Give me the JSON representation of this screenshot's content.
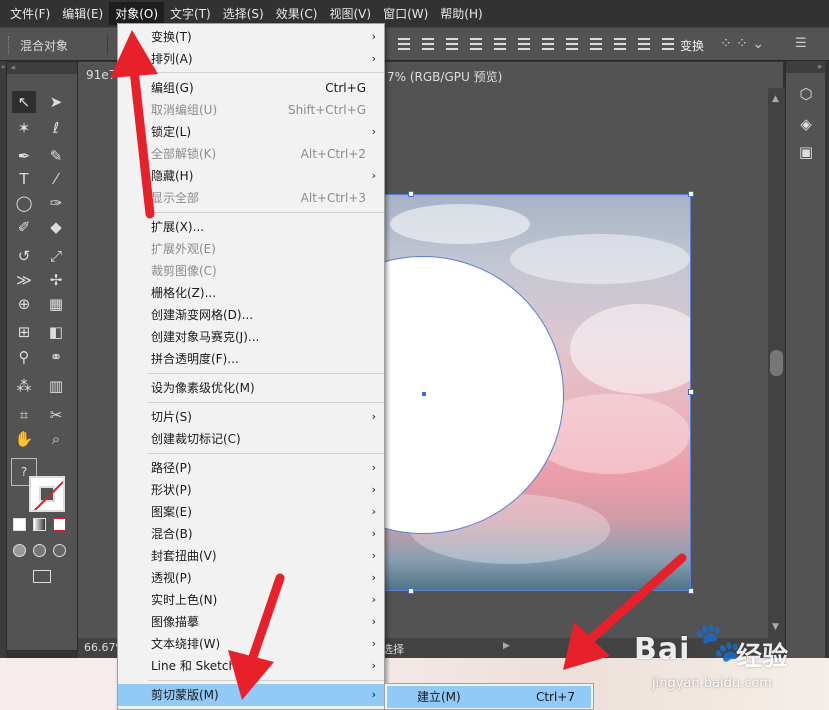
{
  "menubar": {
    "items": [
      "文件(F)",
      "编辑(E)",
      "对象(O)",
      "文字(T)",
      "选择(S)",
      "效果(C)",
      "视图(V)",
      "窗口(W)",
      "帮助(H)"
    ]
  },
  "control_bar": {
    "selection_label": "混合对象",
    "transform_label": "变换"
  },
  "document": {
    "tab_name_start": "91e7",
    "tab_name_end": "7% (RGB/GPU 预览)",
    "zoom": "66.67%",
    "status_text": "选择"
  },
  "object_menu": {
    "items": [
      {
        "label": "变换(T)",
        "shortcut": "",
        "submenu": true,
        "disabled": false
      },
      {
        "label": "排列(A)",
        "shortcut": "",
        "submenu": true,
        "disabled": false
      },
      {
        "label": "编组(G)",
        "shortcut": "Ctrl+G",
        "submenu": false,
        "disabled": false
      },
      {
        "label": "取消编组(U)",
        "shortcut": "Shift+Ctrl+G",
        "submenu": false,
        "disabled": true
      },
      {
        "label": "锁定(L)",
        "shortcut": "",
        "submenu": true,
        "disabled": false
      },
      {
        "label": "全部解锁(K)",
        "shortcut": "Alt+Ctrl+2",
        "submenu": false,
        "disabled": true
      },
      {
        "label": "隐藏(H)",
        "shortcut": "",
        "submenu": true,
        "disabled": false
      },
      {
        "label": "显示全部",
        "shortcut": "Alt+Ctrl+3",
        "submenu": false,
        "disabled": true
      },
      {
        "label": "扩展(X)...",
        "shortcut": "",
        "submenu": false,
        "disabled": false
      },
      {
        "label": "扩展外观(E)",
        "shortcut": "",
        "submenu": false,
        "disabled": true
      },
      {
        "label": "裁剪图像(C)",
        "shortcut": "",
        "submenu": false,
        "disabled": true
      },
      {
        "label": "栅格化(Z)...",
        "shortcut": "",
        "submenu": false,
        "disabled": false
      },
      {
        "label": "创建渐变网格(D)...",
        "shortcut": "",
        "submenu": false,
        "disabled": false
      },
      {
        "label": "创建对象马赛克(J)...",
        "shortcut": "",
        "submenu": false,
        "disabled": false
      },
      {
        "label": "拼合透明度(F)...",
        "shortcut": "",
        "submenu": false,
        "disabled": false
      },
      {
        "label": "设为像素级优化(M)",
        "shortcut": "",
        "submenu": false,
        "disabled": false
      },
      {
        "label": "切片(S)",
        "shortcut": "",
        "submenu": true,
        "disabled": false
      },
      {
        "label": "创建裁切标记(C)",
        "shortcut": "",
        "submenu": false,
        "disabled": false
      },
      {
        "label": "路径(P)",
        "shortcut": "",
        "submenu": true,
        "disabled": false
      },
      {
        "label": "形状(P)",
        "shortcut": "",
        "submenu": true,
        "disabled": false
      },
      {
        "label": "图案(E)",
        "shortcut": "",
        "submenu": true,
        "disabled": false
      },
      {
        "label": "混合(B)",
        "shortcut": "",
        "submenu": true,
        "disabled": false
      },
      {
        "label": "封套扭曲(V)",
        "shortcut": "",
        "submenu": true,
        "disabled": false
      },
      {
        "label": "透视(P)",
        "shortcut": "",
        "submenu": true,
        "disabled": false
      },
      {
        "label": "实时上色(N)",
        "shortcut": "",
        "submenu": true,
        "disabled": false
      },
      {
        "label": "图像描摹",
        "shortcut": "",
        "submenu": true,
        "disabled": false
      },
      {
        "label": "文本绕排(W)",
        "shortcut": "",
        "submenu": true,
        "disabled": false
      },
      {
        "label": "Line 和 Sketch",
        "shortcut": "",
        "submenu": true,
        "disabled": false
      },
      {
        "label": "剪切蒙版(M)",
        "shortcut": "",
        "submenu": true,
        "disabled": false
      }
    ]
  },
  "clipping_submenu": {
    "label": "建立(M)",
    "shortcut": "Ctrl+7"
  },
  "watermark": {
    "brand_latin": "Bai",
    "brand_cn": "经验",
    "url": "jingyan.baidu.com"
  },
  "fill_box_glyph": "?",
  "colors": {
    "highlight": "#91c9f7",
    "annotation_arrow": "#e8202a",
    "selection": "#5b7fd4"
  }
}
